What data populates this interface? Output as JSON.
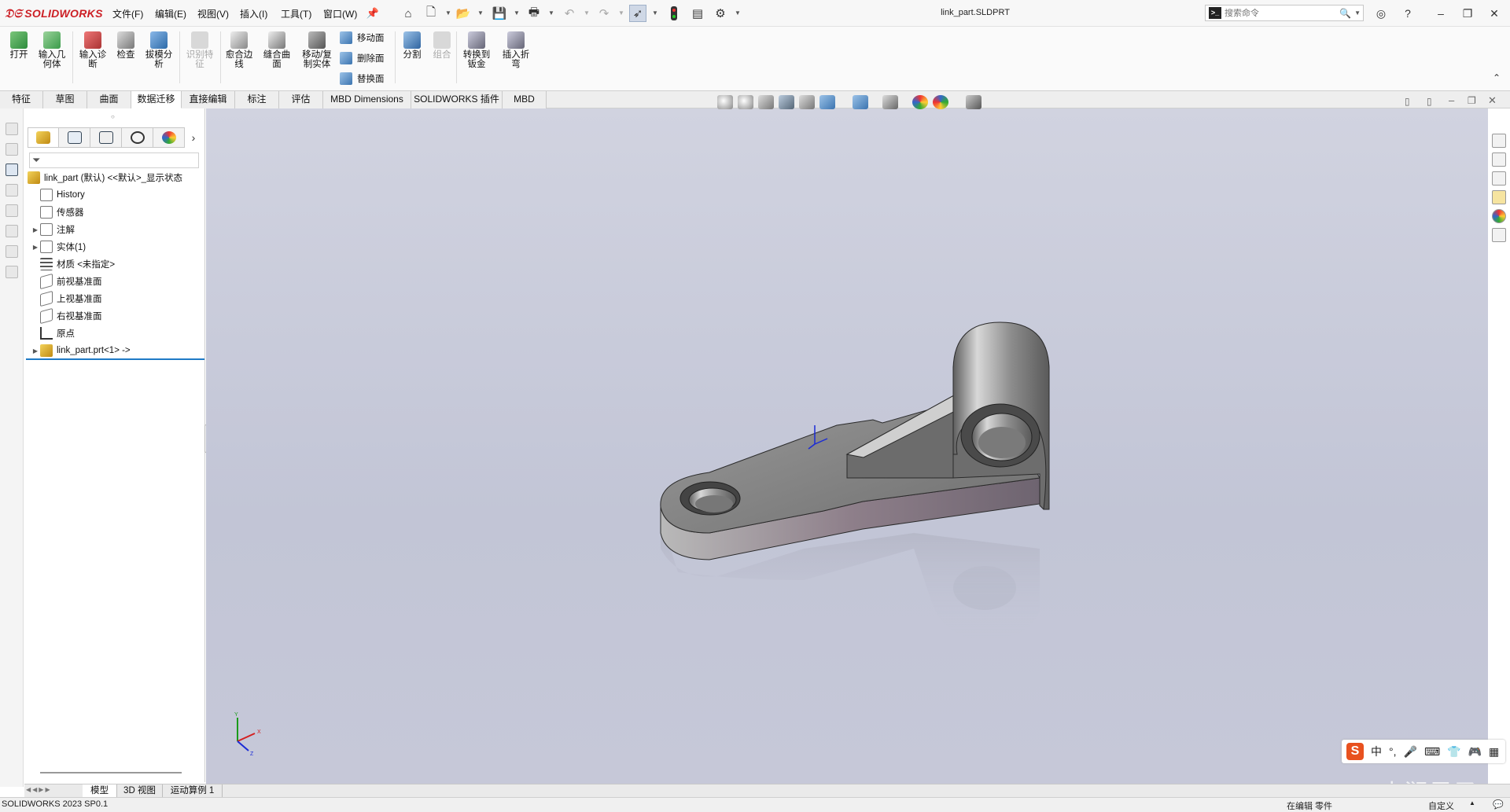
{
  "app": {
    "logo": "SOLIDWORKS",
    "document_title": "link_part.SLDPRT",
    "version_status": "SOLIDWORKS 2023 SP0.1"
  },
  "menus": [
    "文件(F)",
    "编辑(E)",
    "视图(V)",
    "插入(I)",
    "工具(T)",
    "窗口(W)"
  ],
  "search": {
    "placeholder": "搜索命令"
  },
  "ribbon": {
    "buttons": [
      {
        "label": "打开",
        "icon": "open-icon",
        "disabled": false
      },
      {
        "label": "输入几何体",
        "icon": "import-geometry-icon",
        "disabled": false
      },
      {
        "label": "输入诊断",
        "icon": "import-diagnostics-icon",
        "disabled": false
      },
      {
        "label": "检查",
        "icon": "check-icon",
        "disabled": false
      },
      {
        "label": "拔模分析",
        "icon": "draft-analysis-icon",
        "disabled": false
      },
      {
        "label": "识别特征",
        "icon": "feature-recognition-icon",
        "disabled": true
      },
      {
        "label": "愈合边线",
        "icon": "heal-edges-icon",
        "disabled": false
      },
      {
        "label": "缝合曲面",
        "icon": "knit-surface-icon",
        "disabled": false
      },
      {
        "label": "移动/复制实体",
        "icon": "move-copy-body-icon",
        "disabled": false
      },
      {
        "label": "分割",
        "icon": "split-icon",
        "disabled": false
      },
      {
        "label": "组合",
        "icon": "combine-icon",
        "disabled": true
      },
      {
        "label": "转换到钣金",
        "icon": "convert-sheet-metal-icon",
        "disabled": false
      },
      {
        "label": "插入折弯",
        "icon": "insert-bends-icon",
        "disabled": false
      }
    ],
    "small_buttons": [
      {
        "label": "移动面",
        "icon": "move-face-icon"
      },
      {
        "label": "删除面",
        "icon": "delete-face-icon"
      },
      {
        "label": "替换面",
        "icon": "replace-face-icon"
      }
    ]
  },
  "tabs": [
    {
      "label": "特征",
      "active": false
    },
    {
      "label": "草图",
      "active": false
    },
    {
      "label": "曲面",
      "active": false
    },
    {
      "label": "数据迁移",
      "active": true
    },
    {
      "label": "直接编辑",
      "active": false
    },
    {
      "label": "标注",
      "active": false
    },
    {
      "label": "评估",
      "active": false
    },
    {
      "label": "MBD Dimensions",
      "active": false
    },
    {
      "label": "SOLIDWORKS 插件",
      "active": false
    },
    {
      "label": "MBD",
      "active": false
    }
  ],
  "tree": {
    "root": "link_part (默认) <<默认>_显示状态",
    "items": [
      {
        "label": "History",
        "expandable": false
      },
      {
        "label": "传感器",
        "expandable": false
      },
      {
        "label": "注解",
        "expandable": true
      },
      {
        "label": "实体(1)",
        "expandable": true
      },
      {
        "label": "材质 <未指定>",
        "expandable": false
      },
      {
        "label": "前视基准面",
        "expandable": false
      },
      {
        "label": "上视基准面",
        "expandable": false
      },
      {
        "label": "右视基准面",
        "expandable": false
      },
      {
        "label": "原点",
        "expandable": false
      },
      {
        "label": "link_part.prt<1> ->",
        "expandable": true
      }
    ]
  },
  "triad": {
    "x": "X",
    "y": "Y",
    "z": "Z"
  },
  "bottom_tabs": [
    "模型",
    "3D 视图",
    "运动算例 1"
  ],
  "status": {
    "left": "SOLIDWORKS 2023 SP0.1",
    "mode": "在编辑 零件",
    "units": "自定义"
  },
  "ime": {
    "logo": "S",
    "lang": "中"
  },
  "watermark": "CSDN @山涧果子",
  "colors": {
    "accent": "#cc1f25",
    "selection": "#1f7ac6",
    "viewport_top": "#d1d3e0",
    "part_gray": "#8a8a8a"
  }
}
